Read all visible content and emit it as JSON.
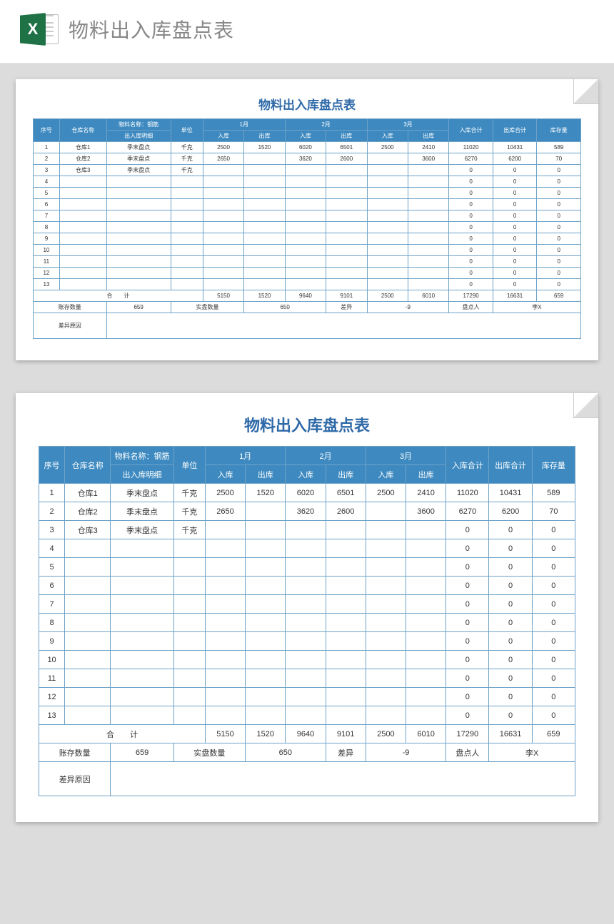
{
  "app": {
    "excel_letter": "X",
    "page_title": "物料出入库盘点表"
  },
  "table": {
    "title": "物料出入库盘点表",
    "headers": {
      "seq": "序号",
      "warehouse": "仓库名称",
      "material_name": "物料名称：钢筋",
      "detail": "出入库明细",
      "unit": "单位",
      "month1": "1月",
      "month2": "2月",
      "month3": "3月",
      "in": "入库",
      "out": "出库",
      "in_total": "入库合计",
      "out_total": "出库合计",
      "stock": "库存量"
    },
    "rows": [
      {
        "seq": "1",
        "warehouse": "仓库1",
        "detail": "季末盘点",
        "unit": "千克",
        "m1in": "2500",
        "m1out": "1520",
        "m2in": "6020",
        "m2out": "6501",
        "m3in": "2500",
        "m3out": "2410",
        "tin": "11020",
        "tout": "10431",
        "stock": "589"
      },
      {
        "seq": "2",
        "warehouse": "仓库2",
        "detail": "季末盘点",
        "unit": "千克",
        "m1in": "2650",
        "m1out": "",
        "m2in": "3620",
        "m2out": "2600",
        "m3in": "",
        "m3out": "3600",
        "tin": "6270",
        "tout": "6200",
        "stock": "70"
      },
      {
        "seq": "3",
        "warehouse": "仓库3",
        "detail": "季末盘点",
        "unit": "千克",
        "m1in": "",
        "m1out": "",
        "m2in": "",
        "m2out": "",
        "m3in": "",
        "m3out": "",
        "tin": "0",
        "tout": "0",
        "stock": "0"
      },
      {
        "seq": "4",
        "warehouse": "",
        "detail": "",
        "unit": "",
        "m1in": "",
        "m1out": "",
        "m2in": "",
        "m2out": "",
        "m3in": "",
        "m3out": "",
        "tin": "0",
        "tout": "0",
        "stock": "0"
      },
      {
        "seq": "5",
        "warehouse": "",
        "detail": "",
        "unit": "",
        "m1in": "",
        "m1out": "",
        "m2in": "",
        "m2out": "",
        "m3in": "",
        "m3out": "",
        "tin": "0",
        "tout": "0",
        "stock": "0"
      },
      {
        "seq": "6",
        "warehouse": "",
        "detail": "",
        "unit": "",
        "m1in": "",
        "m1out": "",
        "m2in": "",
        "m2out": "",
        "m3in": "",
        "m3out": "",
        "tin": "0",
        "tout": "0",
        "stock": "0"
      },
      {
        "seq": "7",
        "warehouse": "",
        "detail": "",
        "unit": "",
        "m1in": "",
        "m1out": "",
        "m2in": "",
        "m2out": "",
        "m3in": "",
        "m3out": "",
        "tin": "0",
        "tout": "0",
        "stock": "0"
      },
      {
        "seq": "8",
        "warehouse": "",
        "detail": "",
        "unit": "",
        "m1in": "",
        "m1out": "",
        "m2in": "",
        "m2out": "",
        "m3in": "",
        "m3out": "",
        "tin": "0",
        "tout": "0",
        "stock": "0"
      },
      {
        "seq": "9",
        "warehouse": "",
        "detail": "",
        "unit": "",
        "m1in": "",
        "m1out": "",
        "m2in": "",
        "m2out": "",
        "m3in": "",
        "m3out": "",
        "tin": "0",
        "tout": "0",
        "stock": "0"
      },
      {
        "seq": "10",
        "warehouse": "",
        "detail": "",
        "unit": "",
        "m1in": "",
        "m1out": "",
        "m2in": "",
        "m2out": "",
        "m3in": "",
        "m3out": "",
        "tin": "0",
        "tout": "0",
        "stock": "0"
      },
      {
        "seq": "11",
        "warehouse": "",
        "detail": "",
        "unit": "",
        "m1in": "",
        "m1out": "",
        "m2in": "",
        "m2out": "",
        "m3in": "",
        "m3out": "",
        "tin": "0",
        "tout": "0",
        "stock": "0"
      },
      {
        "seq": "12",
        "warehouse": "",
        "detail": "",
        "unit": "",
        "m1in": "",
        "m1out": "",
        "m2in": "",
        "m2out": "",
        "m3in": "",
        "m3out": "",
        "tin": "0",
        "tout": "0",
        "stock": "0"
      },
      {
        "seq": "13",
        "warehouse": "",
        "detail": "",
        "unit": "",
        "m1in": "",
        "m1out": "",
        "m2in": "",
        "m2out": "",
        "m3in": "",
        "m3out": "",
        "tin": "0",
        "tout": "0",
        "stock": "0"
      }
    ],
    "totals": {
      "label": "合　　计",
      "m1in": "5150",
      "m1out": "1520",
      "m2in": "9640",
      "m2out": "9101",
      "m3in": "2500",
      "m3out": "6010",
      "tin": "17290",
      "tout": "16631",
      "stock": "659"
    },
    "summary": {
      "book_qty_label": "账存数量",
      "book_qty": "659",
      "actual_qty_label": "实盘数量",
      "actual_qty": "650",
      "diff_label": "差异",
      "diff": "-9",
      "checker_label": "盘点人",
      "checker": "李X",
      "reason_label": "差异原因",
      "reason": ""
    }
  }
}
